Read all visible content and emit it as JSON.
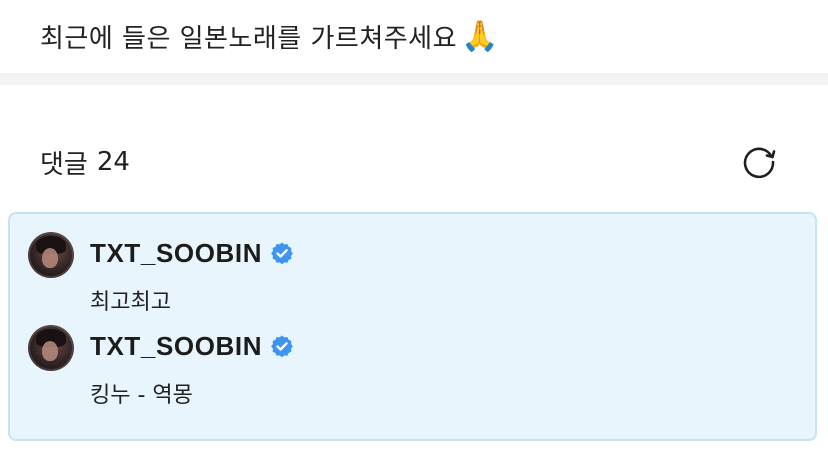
{
  "post": {
    "title": "최근에 들은 일본노래를 가르쳐주세요",
    "title_emoji": "🙏"
  },
  "comments_header": {
    "label": "댓글",
    "count": "24"
  },
  "icons": {
    "refresh": "refresh-icon",
    "verified": "verified-badge-icon"
  },
  "colors": {
    "highlight_bg": "#e9f5fc",
    "highlight_border": "#c6e3f3",
    "verified_blue": "#3d95f0",
    "divider": "#f3f3f6"
  },
  "comments": [
    {
      "username": "TXT_SOOBIN",
      "verified": true,
      "text": "최고최고"
    },
    {
      "username": "TXT_SOOBIN",
      "verified": true,
      "text": "킹누 - 역몽"
    }
  ]
}
